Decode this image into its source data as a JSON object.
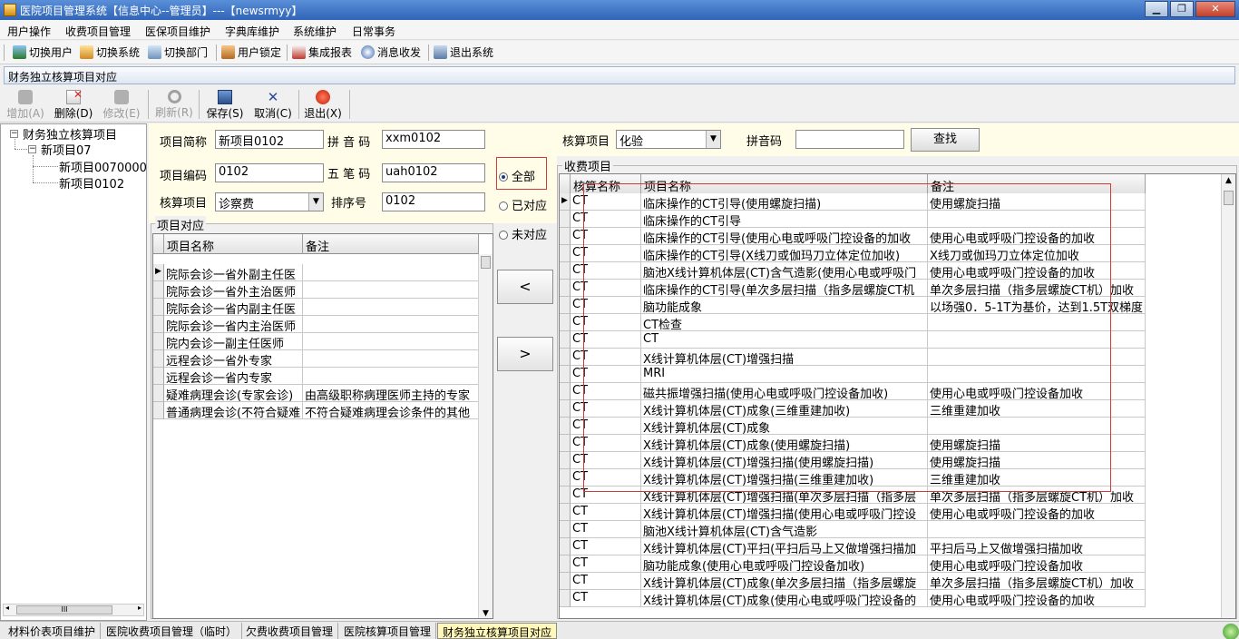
{
  "window": {
    "title": "医院项目管理系统【信息中心--管理员】---【newsrmyy】",
    "btn_min": "▁",
    "btn_max": "❐",
    "btn_close": "✕"
  },
  "menu": [
    "用户操作",
    "收费项目管理",
    "医保项目维护",
    "字典库维护",
    "系统维护",
    "日常事务"
  ],
  "toolbar": [
    "切换用户",
    "切换系统",
    "切换部门",
    "用户锁定",
    "集成报表",
    "消息收发",
    "退出系统"
  ],
  "panel_title": "财务独立核算项目对应",
  "actions": [
    {
      "label": "增加(A)",
      "icon": "add-icon",
      "enabled": false
    },
    {
      "label": "删除(D)",
      "icon": "delete-icon",
      "enabled": true
    },
    {
      "label": "修改(E)",
      "icon": "edit-icon",
      "enabled": false
    },
    {
      "label": "刷新(R)",
      "icon": "refresh-icon",
      "enabled": false
    },
    {
      "label": "保存(S)",
      "icon": "save-icon",
      "enabled": true
    },
    {
      "label": "取消(C)",
      "icon": "cancel-icon",
      "enabled": true
    },
    {
      "label": "退出(X)",
      "icon": "exit-icon",
      "enabled": true
    }
  ],
  "tree": {
    "root": "财务独立核算项目",
    "child": "新项目07",
    "leaves": [
      "新项目0070000",
      "新项目0102"
    ],
    "scroll_thumb": "III"
  },
  "form": {
    "abbr_label": "项目简称",
    "abbr_value": "新项目0102",
    "pinyin_label": "拼 音 码",
    "pinyin_value": "xxm0102",
    "code_label": "项目编码",
    "code_value": "0102",
    "wubi_label": "五 笔 码",
    "wubi_value": "uah0102",
    "acct_label": "核算项目",
    "acct_value": "诊察费",
    "sort_label": "排序号",
    "sort_value": "0102"
  },
  "left_grid": {
    "group_title": "项目对应",
    "headers": [
      "项目名称",
      "备注"
    ],
    "rows": [
      [
        "院际会诊一省外副主任医",
        ""
      ],
      [
        "院际会诊一省外主治医师",
        ""
      ],
      [
        "院际会诊一省内副主任医",
        ""
      ],
      [
        "院际会诊一省内主治医师",
        ""
      ],
      [
        "院内会诊一副主任医师",
        ""
      ],
      [
        "远程会诊一省外专家",
        ""
      ],
      [
        "远程会诊一省内专家",
        ""
      ],
      [
        "疑难病理会诊(专家会诊)",
        "由高级职称病理医师主持的专家"
      ],
      [
        "普通病理会诊(不符合疑难",
        "不符合疑难病理会诊条件的其他"
      ]
    ]
  },
  "radios": [
    {
      "label": "全部",
      "checked": true
    },
    {
      "label": "已对应",
      "checked": false
    },
    {
      "label": "未对应",
      "checked": false
    }
  ],
  "move_buttons": [
    "<",
    ">"
  ],
  "right_form": {
    "acct_label": "核算项目",
    "acct_value": "化验",
    "pinyin_label": "拼音码",
    "pinyin_value": "",
    "search_label": "查找"
  },
  "right_grid": {
    "group_title": "收费项目",
    "headers": [
      "核算名称",
      "项目名称",
      "备注"
    ],
    "rows": [
      [
        "CT",
        "临床操作的CT引导(使用螺旋扫描)",
        "使用螺旋扫描"
      ],
      [
        "CT",
        "临床操作的CT引导",
        ""
      ],
      [
        "CT",
        "临床操作的CT引导(使用心电或呼吸门控设备的加收",
        "使用心电或呼吸门控设备的加收"
      ],
      [
        "CT",
        "临床操作的CT引导(X线刀或伽玛刀立体定位加收)",
        "X线刀或伽玛刀立体定位加收"
      ],
      [
        "CT",
        "脑池X线计算机体层(CT)含气造影(使用心电或呼吸门",
        "使用心电或呼吸门控设备的加收"
      ],
      [
        "CT",
        "临床操作的CT引导(单次多层扫描（指多层螺旋CT机",
        "单次多层扫描（指多层螺旋CT机）加收"
      ],
      [
        "CT",
        "脑功能成象",
        "以场强0．5-1T为基价，达到1.5T双梯度"
      ],
      [
        "CT",
        "CT检查",
        ""
      ],
      [
        "CT",
        "CT",
        ""
      ],
      [
        "CT",
        "X线计算机体层(CT)增强扫描",
        ""
      ],
      [
        "CT",
        "MRI",
        ""
      ],
      [
        "CT",
        "磁共振增强扫描(使用心电或呼吸门控设备加收)",
        "使用心电或呼吸门控设备加收"
      ],
      [
        "CT",
        "X线计算机体层(CT)成象(三维重建加收)",
        "三维重建加收"
      ],
      [
        "CT",
        "X线计算机体层(CT)成象",
        ""
      ],
      [
        "CT",
        "X线计算机体层(CT)成象(使用螺旋扫描)",
        "使用螺旋扫描"
      ],
      [
        "CT",
        "X线计算机体层(CT)增强扫描(使用螺旋扫描)",
        "使用螺旋扫描"
      ],
      [
        "CT",
        "X线计算机体层(CT)增强扫描(三维重建加收)",
        "三维重建加收"
      ],
      [
        "CT",
        "X线计算机体层(CT)增强扫描(单次多层扫描（指多层",
        "单次多层扫描（指多层螺旋CT机）加收"
      ],
      [
        "CT",
        "X线计算机体层(CT)增强扫描(使用心电或呼吸门控设",
        "使用心电或呼吸门控设备的加收"
      ],
      [
        "CT",
        "脑池X线计算机体层(CT)含气造影",
        ""
      ],
      [
        "CT",
        "X线计算机体层(CT)平扫(平扫后马上又做增强扫描加",
        "平扫后马上又做增强扫描加收"
      ],
      [
        "CT",
        "脑功能成象(使用心电或呼吸门控设备加收)",
        "使用心电或呼吸门控设备加收"
      ],
      [
        "CT",
        "X线计算机体层(CT)成象(单次多层扫描（指多层螺旋",
        "单次多层扫描（指多层螺旋CT机）加收"
      ],
      [
        "CT",
        "X线计算机体层(CT)成象(使用心电或呼吸门控设备的",
        "使用心电或呼吸门控设备的加收"
      ]
    ]
  },
  "status_tabs": [
    "材料价表项目维护",
    "医院收费项目管理（临时）",
    "欠费收费项目管理",
    "医院核算项目管理",
    "财务独立核算项目对应"
  ],
  "colors": {
    "accent": "#2f64b8",
    "form_bg": "#fffde8",
    "active_tab": "#fff8b8",
    "highlight": "#d23a3a"
  }
}
